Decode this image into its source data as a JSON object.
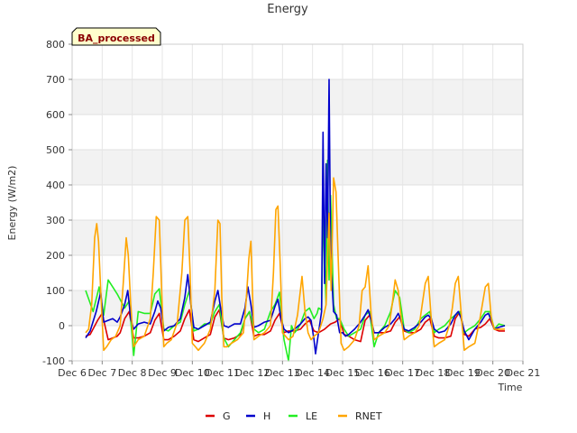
{
  "chart_data": {
    "type": "line",
    "title": "Energy",
    "xlabel": "Time",
    "ylabel": "Energy (W/m2)",
    "badge": "BA_processed",
    "ylim": [
      -100,
      800
    ],
    "yticks": [
      -100,
      0,
      100,
      200,
      300,
      400,
      500,
      600,
      700,
      800
    ],
    "xlim": [
      6,
      21
    ],
    "xticks": [
      6,
      7,
      8,
      9,
      10,
      11,
      12,
      13,
      14,
      15,
      16,
      17,
      18,
      19,
      20,
      21
    ],
    "xtick_labels": [
      "Dec 6",
      "Dec 7",
      "Dec 8",
      "Dec 9",
      "Dec 10",
      "Dec 11",
      "Dec 12",
      "Dec 13",
      "Dec 14",
      "Dec 15",
      "Dec 16",
      "Dec 17",
      "Dec 18",
      "Dec 19",
      "Dec 20",
      "Dec 21"
    ],
    "grid": true,
    "legend_position": "bottom",
    "series": [
      {
        "name": "G",
        "color": "#dd0000",
        "x": [
          6.45,
          6.6,
          6.85,
          7.0,
          7.2,
          7.35,
          7.5,
          7.6,
          7.75,
          7.9,
          8.05,
          8.2,
          8.4,
          8.6,
          8.75,
          8.9,
          9.05,
          9.2,
          9.4,
          9.6,
          9.75,
          9.9,
          10.05,
          10.2,
          10.4,
          10.6,
          10.75,
          10.9,
          11.05,
          11.2,
          11.4,
          11.6,
          11.75,
          11.9,
          12.05,
          12.2,
          12.4,
          12.6,
          12.75,
          12.9,
          13.05,
          13.2,
          13.4,
          13.6,
          13.75,
          13.9,
          14.05,
          14.2,
          14.4,
          14.6,
          14.75,
          14.9,
          15.05,
          15.2,
          15.4,
          15.6,
          15.75,
          15.9,
          16.05,
          16.2,
          16.4,
          16.6,
          16.75,
          16.9,
          17.05,
          17.2,
          17.4,
          17.6,
          17.75,
          17.9,
          18.05,
          18.2,
          18.4,
          18.6,
          18.75,
          18.9,
          19.05,
          19.2,
          19.4,
          19.6,
          19.75,
          19.9,
          20.05,
          20.2,
          20.4
        ],
        "y": [
          -30,
          -25,
          15,
          35,
          -40,
          -35,
          -30,
          -20,
          20,
          40,
          -35,
          -35,
          -30,
          -20,
          15,
          35,
          -40,
          -40,
          -30,
          -15,
          20,
          45,
          -40,
          -45,
          -35,
          -25,
          25,
          45,
          -35,
          -40,
          -35,
          -25,
          20,
          40,
          -30,
          -25,
          -25,
          -15,
          15,
          35,
          -20,
          -15,
          -15,
          -10,
          5,
          15,
          -15,
          -20,
          -10,
          5,
          10,
          20,
          -25,
          -30,
          -40,
          -45,
          15,
          30,
          -20,
          -20,
          -20,
          -15,
          10,
          25,
          -15,
          -20,
          -20,
          -10,
          10,
          20,
          -30,
          -35,
          -35,
          -30,
          20,
          40,
          -25,
          -30,
          -10,
          -5,
          5,
          20,
          -10,
          -15,
          -15
        ]
      },
      {
        "name": "H",
        "color": "#0000cc",
        "x": [
          6.45,
          6.6,
          6.8,
          6.95,
          7.05,
          7.2,
          7.35,
          7.5,
          7.6,
          7.75,
          7.85,
          7.95,
          8.05,
          8.2,
          8.4,
          8.6,
          8.75,
          8.85,
          8.95,
          9.05,
          9.2,
          9.4,
          9.6,
          9.75,
          9.85,
          9.95,
          10.05,
          10.2,
          10.4,
          10.6,
          10.75,
          10.85,
          10.95,
          11.05,
          11.2,
          11.4,
          11.6,
          11.75,
          11.85,
          11.95,
          12.05,
          12.2,
          12.4,
          12.6,
          12.75,
          12.85,
          12.95,
          13.05,
          13.2,
          13.4,
          13.6,
          13.75,
          13.85,
          13.95,
          14.05,
          14.1,
          14.2,
          14.3,
          14.35,
          14.4,
          14.45,
          14.5,
          14.55,
          14.6,
          14.7,
          14.8,
          14.9,
          15.0,
          15.1,
          15.2,
          15.4,
          15.6,
          15.75,
          15.85,
          15.95,
          16.05,
          16.2,
          16.4,
          16.6,
          16.75,
          16.85,
          16.95,
          17.05,
          17.2,
          17.4,
          17.6,
          17.75,
          17.85,
          17.95,
          18.05,
          18.2,
          18.4,
          18.6,
          18.75,
          18.85,
          18.95,
          19.05,
          19.2,
          19.4,
          19.6,
          19.75,
          19.85,
          19.95,
          20.05,
          20.2,
          20.4
        ],
        "y": [
          -35,
          -15,
          40,
          95,
          10,
          15,
          20,
          10,
          25,
          60,
          100,
          20,
          -10,
          5,
          10,
          5,
          40,
          70,
          50,
          -15,
          -5,
          0,
          20,
          80,
          145,
          60,
          -5,
          -10,
          0,
          10,
          70,
          100,
          45,
          0,
          -5,
          5,
          5,
          50,
          110,
          60,
          -5,
          0,
          10,
          15,
          55,
          75,
          20,
          -10,
          -20,
          -10,
          5,
          20,
          25,
          15,
          -40,
          -80,
          -20,
          40,
          550,
          120,
          460,
          250,
          700,
          200,
          40,
          30,
          -20,
          -20,
          -30,
          -25,
          -10,
          10,
          30,
          45,
          15,
          -20,
          -20,
          -5,
          5,
          20,
          35,
          15,
          -10,
          -15,
          -5,
          10,
          25,
          30,
          20,
          -10,
          -20,
          -15,
          5,
          30,
          40,
          20,
          -15,
          -40,
          -10,
          10,
          30,
          35,
          15,
          -10,
          -5,
          0
        ]
      },
      {
        "name": "LE",
        "color": "#22ee22",
        "x": [
          6.45,
          6.7,
          6.9,
          7.05,
          7.2,
          7.5,
          7.75,
          7.9,
          8.05,
          8.2,
          8.4,
          8.6,
          8.75,
          8.9,
          9.05,
          9.2,
          9.4,
          9.6,
          9.75,
          9.9,
          10.05,
          10.2,
          10.4,
          10.6,
          10.75,
          10.9,
          11.05,
          11.2,
          11.4,
          11.6,
          11.75,
          11.9,
          12.05,
          12.2,
          12.4,
          12.6,
          12.75,
          12.9,
          13.05,
          13.2,
          13.3,
          13.4,
          13.5,
          13.6,
          13.75,
          13.9,
          14.05,
          14.15,
          14.2,
          14.3,
          14.35,
          14.45,
          14.5,
          14.55,
          14.6,
          14.7,
          14.8,
          14.9,
          15.05,
          15.2,
          15.4,
          15.6,
          15.75,
          15.9,
          16.05,
          16.2,
          16.4,
          16.6,
          16.75,
          16.9,
          17.05,
          17.2,
          17.4,
          17.6,
          17.75,
          17.9,
          18.05,
          18.2,
          18.4,
          18.6,
          18.75,
          18.9,
          19.05,
          19.2,
          19.4,
          19.6,
          19.75,
          19.9,
          20.05,
          20.2,
          20.4
        ],
        "y": [
          100,
          40,
          110,
          30,
          130,
          90,
          50,
          70,
          -85,
          40,
          35,
          35,
          90,
          105,
          -10,
          -15,
          0,
          10,
          60,
          100,
          -15,
          -10,
          5,
          5,
          40,
          60,
          -35,
          -60,
          -40,
          -20,
          20,
          40,
          -10,
          -20,
          -10,
          40,
          60,
          95,
          -40,
          -100,
          0,
          -20,
          -10,
          5,
          40,
          50,
          20,
          35,
          50,
          45,
          320,
          60,
          470,
          130,
          370,
          60,
          20,
          20,
          -10,
          -30,
          -20,
          -10,
          30,
          40,
          -60,
          -20,
          0,
          40,
          100,
          80,
          -10,
          -20,
          -10,
          20,
          30,
          40,
          -20,
          -10,
          0,
          20,
          30,
          40,
          -20,
          -10,
          0,
          20,
          40,
          40,
          -10,
          5,
          0
        ]
      },
      {
        "name": "RNET",
        "color": "#ffa500",
        "x": [
          6.45,
          6.55,
          6.65,
          6.75,
          6.82,
          6.88,
          6.95,
          7.05,
          7.15,
          7.3,
          7.45,
          7.6,
          7.7,
          7.8,
          7.87,
          7.95,
          8.05,
          8.2,
          8.4,
          8.6,
          8.7,
          8.8,
          8.9,
          8.97,
          9.05,
          9.15,
          9.3,
          9.5,
          9.65,
          9.75,
          9.85,
          9.92,
          10.0,
          10.1,
          10.2,
          10.4,
          10.6,
          10.75,
          10.85,
          10.92,
          10.98,
          11.05,
          11.15,
          11.3,
          11.5,
          11.7,
          11.8,
          11.88,
          11.95,
          12.05,
          12.2,
          12.4,
          12.6,
          12.7,
          12.78,
          12.85,
          12.92,
          13.0,
          13.1,
          13.2,
          13.35,
          13.5,
          13.65,
          13.75,
          13.85,
          13.95,
          14.05,
          14.2,
          14.35,
          14.45,
          14.55,
          14.62,
          14.7,
          14.78,
          14.85,
          14.95,
          15.05,
          15.2,
          15.4,
          15.55,
          15.65,
          15.75,
          15.85,
          15.95,
          16.05,
          16.2,
          16.4,
          16.55,
          16.65,
          16.75,
          16.85,
          16.95,
          17.05,
          17.2,
          17.4,
          17.55,
          17.65,
          17.75,
          17.85,
          17.95,
          18.05,
          18.2,
          18.4,
          18.55,
          18.65,
          18.75,
          18.85,
          18.95,
          19.05,
          19.2,
          19.4,
          19.55,
          19.65,
          19.75,
          19.85,
          19.95,
          20.05,
          20.2,
          20.4
        ],
        "y": [
          -20,
          -10,
          60,
          250,
          290,
          240,
          100,
          -70,
          -60,
          -40,
          -30,
          0,
          120,
          250,
          200,
          60,
          -60,
          -40,
          -30,
          20,
          150,
          310,
          300,
          120,
          -60,
          -50,
          -40,
          10,
          150,
          300,
          310,
          160,
          -50,
          -60,
          -70,
          -50,
          -10,
          100,
          300,
          290,
          80,
          -60,
          -60,
          -50,
          -40,
          -20,
          80,
          190,
          240,
          -40,
          -30,
          -20,
          0,
          150,
          330,
          340,
          180,
          -20,
          -30,
          -40,
          -30,
          30,
          140,
          40,
          -20,
          -40,
          -30,
          -20,
          20,
          60,
          320,
          100,
          420,
          380,
          200,
          -50,
          -70,
          -60,
          -40,
          0,
          100,
          110,
          170,
          30,
          -40,
          -30,
          -20,
          0,
          60,
          130,
          100,
          20,
          -40,
          -30,
          -20,
          0,
          60,
          120,
          140,
          20,
          -60,
          -50,
          -40,
          0,
          50,
          120,
          140,
          30,
          -70,
          -60,
          -50,
          10,
          60,
          110,
          120,
          20,
          -10,
          -10,
          -10
        ]
      }
    ]
  }
}
